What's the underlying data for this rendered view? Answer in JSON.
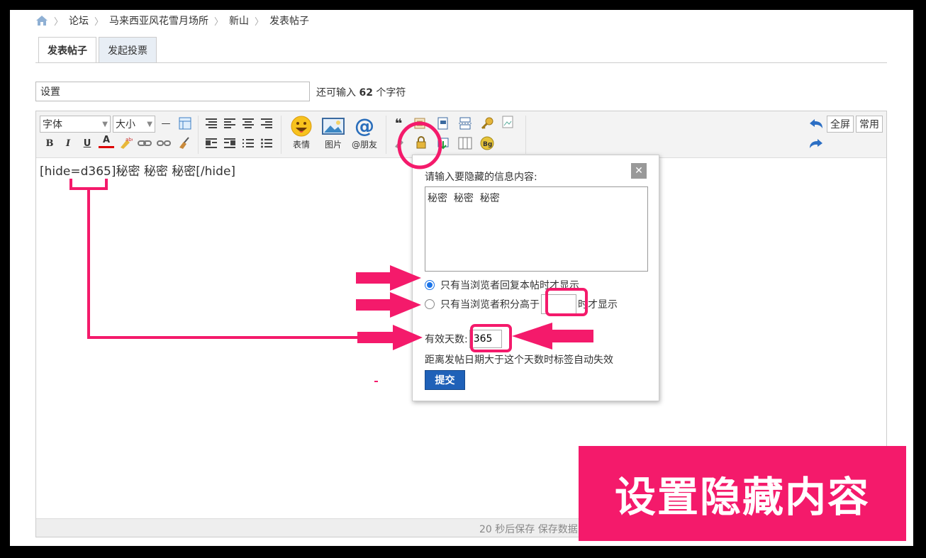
{
  "breadcrumb": {
    "items": [
      "论坛",
      "马来西亚风花雪月场所",
      "新山",
      "发表帖子"
    ],
    "separator": "〉"
  },
  "tabs": [
    {
      "label": "发表帖子",
      "active": true
    },
    {
      "label": "发起投票",
      "active": false
    }
  ],
  "subject": {
    "value": "设置",
    "char_left_prefix": "还可输入",
    "char_left_count": "62",
    "char_left_suffix": "个字符"
  },
  "toolbar": {
    "font_label": "字体",
    "size_label": "大小",
    "emoji_label": "表情",
    "image_label": "图片",
    "mention_label": "@朋友",
    "fullscreen_label": "全屏",
    "common_label": "常用",
    "bold": "B",
    "italic": "I",
    "underline": "U",
    "color": "A",
    "quote": "❝",
    "bg": "Bg"
  },
  "editor": {
    "content": "[hide=d365]秘密  秘密  秘密[/hide]",
    "autosave": "20 秒后保存 保存数据"
  },
  "popup": {
    "title": "请输入要隐藏的信息内容:",
    "content": "秘密  秘密  秘密",
    "option_reply": "只有当浏览者回复本帖时才显示",
    "option_points_prefix": "只有当浏览者积分高于",
    "option_points_suffix": "时才显示",
    "days_label": "有效天数:",
    "days_value": "365",
    "days_hint": "距离发帖日期大于这个天数时标签自动失效",
    "submit": "提交",
    "close": "✕"
  },
  "annotation": {
    "label": "设置隐藏内容"
  },
  "colors": {
    "accent": "#f41a6b",
    "submit": "#1f61b8",
    "radio": "#1a73e8"
  }
}
